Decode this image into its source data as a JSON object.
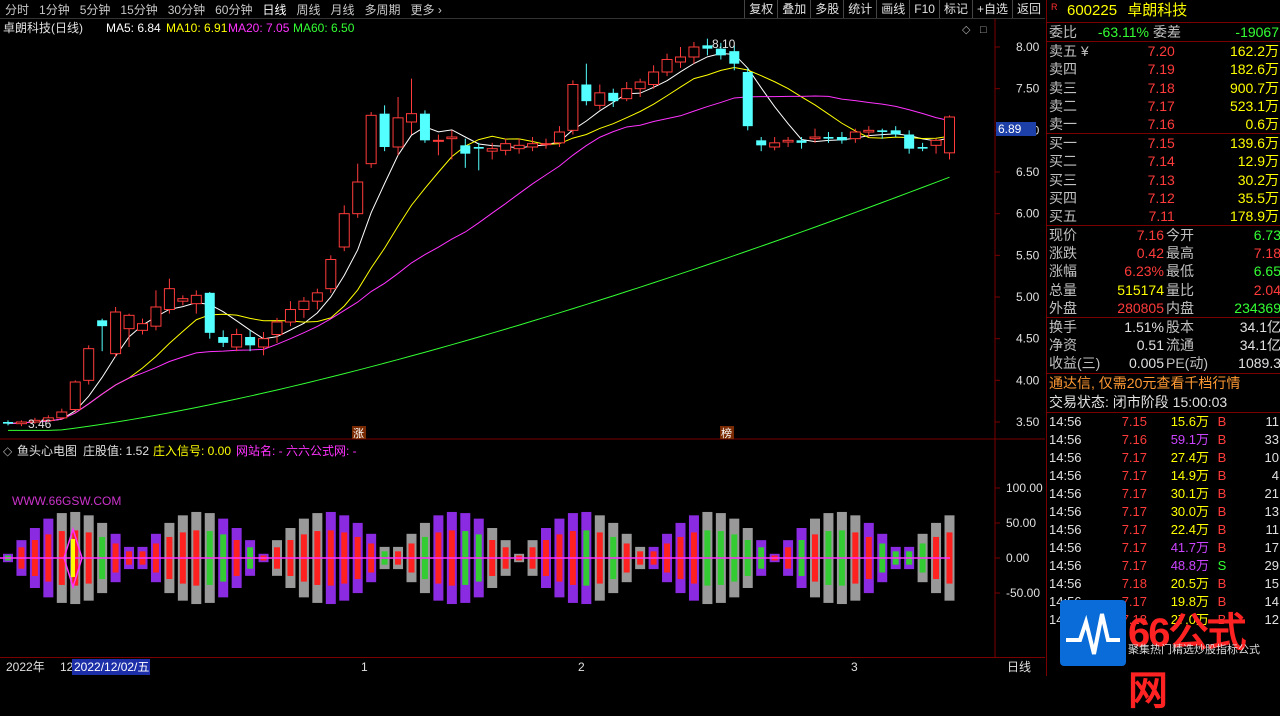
{
  "toolbar": {
    "timeframes": [
      "分时",
      "1分钟",
      "5分钟",
      "15分钟",
      "30分钟",
      "60分钟",
      "日线",
      "周线",
      "月线",
      "多周期",
      "更多 ›"
    ],
    "active_index": 6,
    "tools": [
      "复权",
      "叠加",
      "多股",
      "统计",
      "画线",
      "F10",
      "标记",
      "+自选",
      "返回"
    ]
  },
  "main_chart": {
    "title": "卓朗科技(日线)",
    "ma5_label": "MA5: 6.84",
    "ma10_label": "MA10: 6.91",
    "ma20_label": "MA20: 7.05",
    "ma60_label": "MA60: 6.50",
    "high_mark": "8.10",
    "low_mark": "3.46",
    "price_tag": "6.89",
    "y_ticks": [
      "8.00",
      "7.50",
      "7.00",
      "6.50",
      "6.00",
      "5.50",
      "5.00",
      "4.50",
      "4.00",
      "3.50"
    ],
    "event_labels": [
      "涨",
      "榜"
    ],
    "colors": {
      "up": "#ff3b3b",
      "down": "#54ffff",
      "ma5": "#ffffff",
      "ma10": "#ffff00",
      "ma20": "#ff33ff",
      "ma60": "#33ff33"
    }
  },
  "indicator": {
    "name": "鱼头心电图",
    "param1": "庄股值: 1.52",
    "param2": "庄入信号: 0.00",
    "param3": "网站名: - 六六公式网: -",
    "watermark": "WWW.66GSW.COM",
    "y_ticks": [
      "100.00",
      "50.00",
      "0.00",
      "-50.00"
    ]
  },
  "x_axis": {
    "year": "2022年",
    "cursor_date": "2022/12/02/五",
    "months": [
      "1",
      "2",
      "3"
    ],
    "period": "日线",
    "prefix": "12"
  },
  "quote_panel": {
    "code": "600225",
    "name": "卓朗科技",
    "flag": "R",
    "weibi_label": "委比",
    "weibi": "-63.11%",
    "weicha_label": "委差",
    "weicha": "-19067",
    "asks": [
      {
        "label": "卖五 ¥",
        "price": "7.20",
        "vol": "162.2万"
      },
      {
        "label": "卖四",
        "price": "7.19",
        "vol": "182.6万"
      },
      {
        "label": "卖三",
        "price": "7.18",
        "vol": "900.7万"
      },
      {
        "label": "卖二",
        "price": "7.17",
        "vol": "523.1万"
      },
      {
        "label": "卖一",
        "price": "7.16",
        "vol": "0.6万"
      }
    ],
    "bids": [
      {
        "label": "买一",
        "price": "7.15",
        "vol": "139.6万"
      },
      {
        "label": "买二",
        "price": "7.14",
        "vol": "12.9万"
      },
      {
        "label": "买三",
        "price": "7.13",
        "vol": "30.2万"
      },
      {
        "label": "买四",
        "price": "7.12",
        "vol": "35.5万"
      },
      {
        "label": "买五",
        "price": "7.11",
        "vol": "178.9万"
      }
    ],
    "stats": [
      {
        "a": "现价",
        "b": "7.16",
        "bc": "red",
        "c": "今开",
        "d": "6.73",
        "dc": "green"
      },
      {
        "a": "涨跌",
        "b": "0.42",
        "bc": "red",
        "c": "最高",
        "d": "7.18",
        "dc": "red"
      },
      {
        "a": "涨幅",
        "b": "6.23%",
        "bc": "red",
        "c": "最低",
        "d": "6.65",
        "dc": "green"
      },
      {
        "a": "总量",
        "b": "515174",
        "bc": "yellow",
        "c": "量比",
        "d": "2.04",
        "dc": "red"
      },
      {
        "a": "外盘",
        "b": "280805",
        "bc": "red",
        "c": "内盘",
        "d": "234369",
        "dc": "green"
      }
    ],
    "stats2": [
      {
        "a": "换手",
        "b": "1.51%",
        "bc": "white",
        "c": "股本",
        "d": "34.1亿",
        "dc": "white"
      },
      {
        "a": "净资",
        "b": "0.51",
        "bc": "white",
        "c": "流通",
        "d": "34.1亿",
        "dc": "white"
      },
      {
        "a": "收益(三)",
        "b": "0.005",
        "bc": "white",
        "c": "PE(动)",
        "d": "1089.3",
        "dc": "white"
      }
    ],
    "notice": "通达信, 仅需20元查看千档行情",
    "state": "交易状态: 闭市阶段 15:00:03",
    "ticks": [
      {
        "t": "14:56",
        "p": "7.15",
        "pc": "red",
        "v": "15.6万",
        "vc": "yellow",
        "s": "B",
        "sc": "red",
        "n": "11"
      },
      {
        "t": "14:56",
        "p": "7.16",
        "pc": "red",
        "v": "59.1万",
        "vc": "purple",
        "s": "B",
        "sc": "red",
        "n": "33"
      },
      {
        "t": "14:56",
        "p": "7.17",
        "pc": "red",
        "v": "27.4万",
        "vc": "yellow",
        "s": "B",
        "sc": "red",
        "n": "10"
      },
      {
        "t": "14:56",
        "p": "7.17",
        "pc": "red",
        "v": "14.9万",
        "vc": "yellow",
        "s": "B",
        "sc": "red",
        "n": "4"
      },
      {
        "t": "14:56",
        "p": "7.17",
        "pc": "red",
        "v": "30.1万",
        "vc": "yellow",
        "s": "B",
        "sc": "red",
        "n": "21"
      },
      {
        "t": "14:56",
        "p": "7.17",
        "pc": "red",
        "v": "30.0万",
        "vc": "yellow",
        "s": "B",
        "sc": "red",
        "n": "13"
      },
      {
        "t": "14:56",
        "p": "7.17",
        "pc": "red",
        "v": "22.4万",
        "vc": "yellow",
        "s": "B",
        "sc": "red",
        "n": "11"
      },
      {
        "t": "14:56",
        "p": "7.17",
        "pc": "red",
        "v": "41.7万",
        "vc": "purple",
        "s": "B",
        "sc": "red",
        "n": "17"
      },
      {
        "t": "14:56",
        "p": "7.17",
        "pc": "red",
        "v": "48.8万",
        "vc": "purple",
        "s": "S",
        "sc": "green",
        "n": "29"
      },
      {
        "t": "14:56",
        "p": "7.18",
        "pc": "red",
        "v": "20.5万",
        "vc": "yellow",
        "s": "B",
        "sc": "red",
        "n": "15"
      },
      {
        "t": "14:56",
        "p": "7.17",
        "pc": "red",
        "v": "19.8万",
        "vc": "yellow",
        "s": "B",
        "sc": "red",
        "n": "14"
      },
      {
        "t": "14:56",
        "p": "7.18",
        "pc": "red",
        "v": "27.0万",
        "vc": "yellow",
        "s": "B",
        "sc": "red",
        "n": "12"
      }
    ]
  },
  "brand": {
    "logo_text": "66公式网",
    "sub": "聚集热门精选炒股指标公式"
  }
}
